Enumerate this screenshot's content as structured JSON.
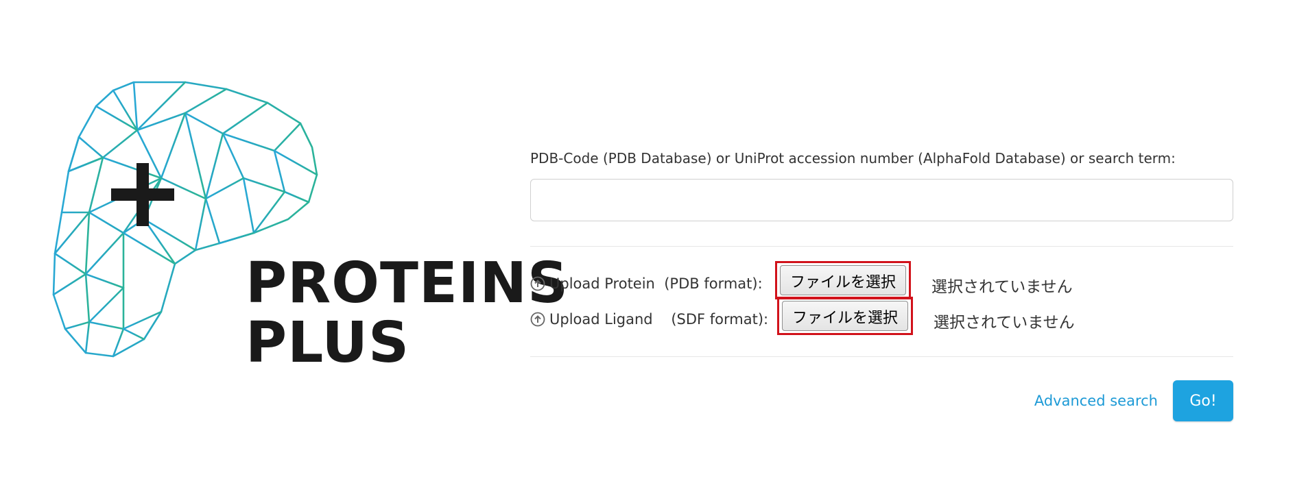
{
  "logo": {
    "line1": "PROTEINS",
    "line2": "PLUS",
    "plus_symbol": "+",
    "gradient_colors": [
      "#2aa9d8",
      "#2bb39a"
    ]
  },
  "search": {
    "label": "PDB-Code (PDB Database) or UniProt accession number (AlphaFold Database) or search term:",
    "value": "",
    "placeholder": ""
  },
  "uploads": [
    {
      "icon": "upload-circle-icon",
      "label": "Upload Protein  (PDB format):",
      "button_label": "ファイルを選択",
      "status": "選択されていません"
    },
    {
      "icon": "upload-circle-icon",
      "label": "Upload Ligand    (SDF format):",
      "button_label": "ファイルを選択",
      "status": "選択されていません"
    }
  ],
  "actions": {
    "advanced_search": "Advanced search",
    "go": "Go!"
  },
  "colors": {
    "accent": "#1ea3e0",
    "link": "#1d9ad6",
    "highlight_border": "#d1121b"
  }
}
